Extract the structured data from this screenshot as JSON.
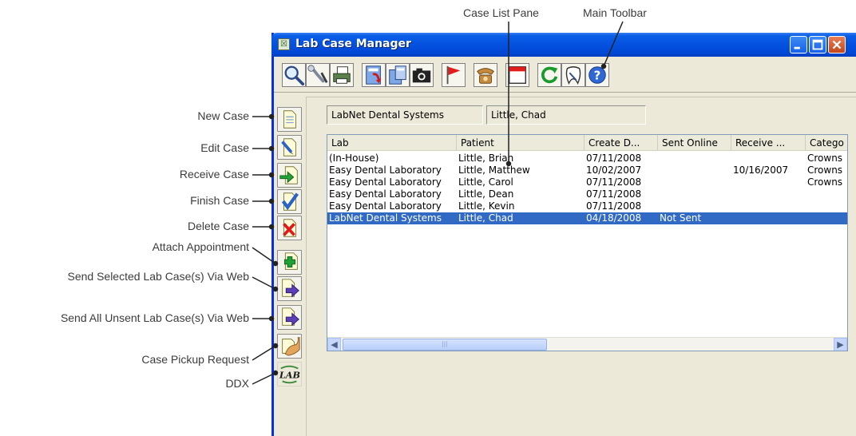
{
  "annotations": {
    "top": [
      {
        "label": "Case List Pane"
      },
      {
        "label": "Main Toolbar"
      }
    ],
    "left": [
      {
        "label": "New Case"
      },
      {
        "label": "Edit Case"
      },
      {
        "label": "Receive Case"
      },
      {
        "label": "Finish Case"
      },
      {
        "label": "Delete Case"
      },
      {
        "label": "Attach Appointment"
      },
      {
        "label": "Send Selected Lab Case(s) Via Web"
      },
      {
        "label": "Send All Unsent Lab Case(s) Via Web"
      },
      {
        "label": "Case Pickup Request"
      },
      {
        "label": "DDX"
      }
    ]
  },
  "window": {
    "title": "Lab Case Manager",
    "title_icon": "lab-case-app-icon",
    "controls": [
      "minimize",
      "maximize",
      "close"
    ]
  },
  "toolbar": {
    "buttons": [
      {
        "icon": "magnifier-search-icon"
      },
      {
        "icon": "wrench-setup-icon"
      },
      {
        "icon": "printer-icon"
      },
      {
        "icon": "report-icon"
      },
      {
        "icon": "report-sheet-icon"
      },
      {
        "icon": "camera-icon"
      },
      {
        "icon": "red-flag-icon"
      },
      {
        "icon": "telephone-icon"
      },
      {
        "icon": "calendar-icon"
      },
      {
        "icon": "refresh-icon"
      },
      {
        "icon": "tooth-icon"
      },
      {
        "icon": "help-icon"
      }
    ]
  },
  "sidebar": {
    "buttons": [
      {
        "name": "new-case",
        "icon": "new-document-icon"
      },
      {
        "name": "edit-case",
        "icon": "edit-document-icon"
      },
      {
        "name": "receive-case",
        "icon": "receive-document-icon"
      },
      {
        "name": "finish-case",
        "icon": "finish-check-icon"
      },
      {
        "name": "delete-case",
        "icon": "delete-x-icon"
      },
      {
        "name": "attach-appointment",
        "icon": "attach-plus-icon"
      },
      {
        "name": "send-selected-via-web",
        "icon": "send-arrow-icon"
      },
      {
        "name": "send-all-unsent-via-web",
        "icon": "send-arrow-icon"
      },
      {
        "name": "case-pickup-request",
        "icon": "pickup-hand-icon"
      },
      {
        "name": "ddx",
        "icon": "lab-ddx-icon",
        "text": "LAB"
      }
    ]
  },
  "info": {
    "lab": "LabNet Dental Systems",
    "patient": "Little, Chad"
  },
  "case_list": {
    "columns": [
      "Lab",
      "Patient",
      "Create D...",
      "Sent Online",
      "Receive ...",
      "Catego"
    ],
    "rows": [
      [
        "(In-House)",
        "Little, Brian",
        "07/11/2008",
        "",
        "",
        "Crowns"
      ],
      [
        "Easy Dental Laboratory",
        "Little, Matthew",
        "10/02/2007",
        "",
        "10/16/2007",
        "Crowns"
      ],
      [
        "Easy Dental Laboratory",
        "Little, Carol",
        "07/11/2008",
        "",
        "",
        "Crowns"
      ],
      [
        "Easy Dental Laboratory",
        "Little, Dean",
        "07/11/2008",
        "",
        "",
        ""
      ],
      [
        "Easy Dental Laboratory",
        "Little, Kevin",
        "07/11/2008",
        "",
        "",
        ""
      ],
      [
        "LabNet Dental Systems",
        "Little, Chad",
        "04/18/2008",
        "Not Sent",
        "",
        ""
      ]
    ],
    "selected_row": 5,
    "scroll_thumb_glyph": "|||"
  },
  "colors": {
    "title_bar": "#0551e0",
    "selection": "#316ac5",
    "window_face": "#ece9d8"
  }
}
